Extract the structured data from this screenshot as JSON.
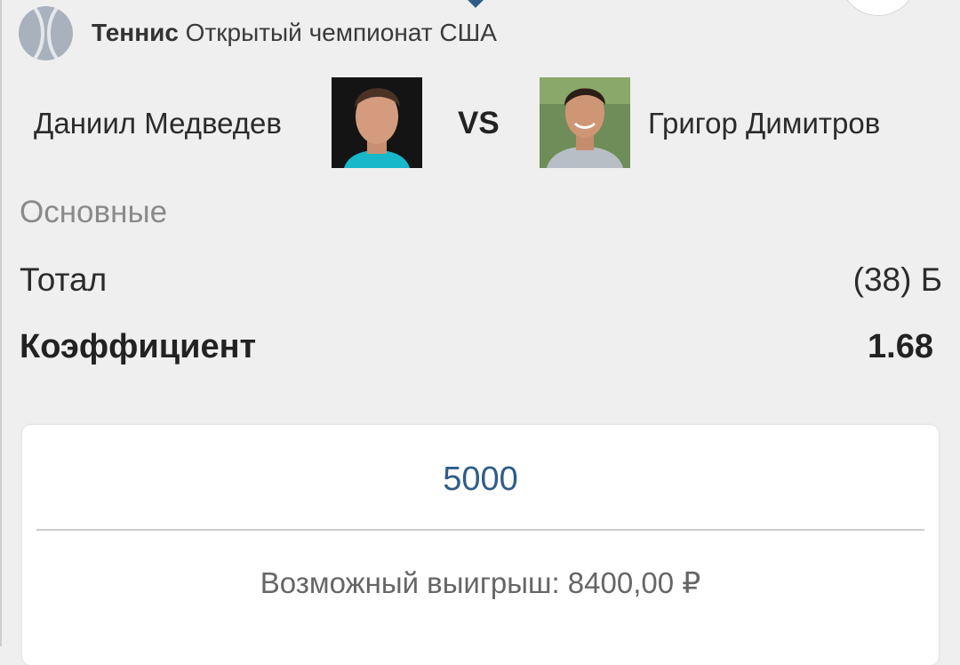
{
  "event": {
    "sport": "Теннис",
    "tournament": "Открытый чемпионат США",
    "sport_icon": "tennis-ball-icon"
  },
  "players": {
    "player1": "Даниил Медведев",
    "player2": "Григор Димитров",
    "vs": "VS"
  },
  "market": {
    "section": "Основные",
    "bet_label": "Тотал",
    "bet_value": "(38) Б",
    "coef_label": "Коэффициент",
    "coef_value": "1.68"
  },
  "bet_slip": {
    "stake": "5000",
    "payout": "Возможный выигрыш: 8400,00 ₽"
  },
  "colors": {
    "accent": "#2f5d8a",
    "background": "#efefef",
    "card": "#ffffff"
  }
}
